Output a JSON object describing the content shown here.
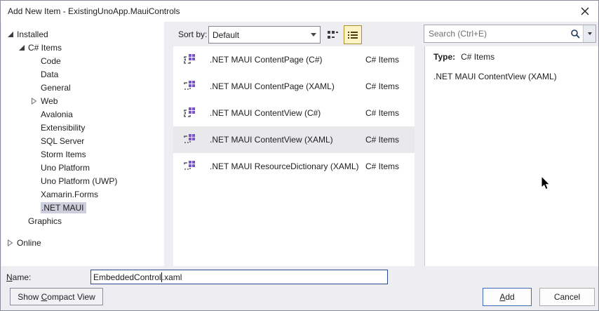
{
  "window": {
    "title": "Add New Item - ExistingUnoApp.MauiControls"
  },
  "toolbar": {
    "sort_by_label": "Sort by:",
    "sort_value": "Default",
    "search_placeholder": "Search (Ctrl+E)"
  },
  "tree": {
    "items": [
      {
        "label": "Installed",
        "state": "expanded",
        "level": 0
      },
      {
        "label": "C# Items",
        "state": "expanded",
        "level": 1
      },
      {
        "label": "Code",
        "level": 2
      },
      {
        "label": "Data",
        "level": 2
      },
      {
        "label": "General",
        "level": 2
      },
      {
        "label": "Web",
        "state": "collapsed",
        "level": 2
      },
      {
        "label": "Avalonia",
        "level": 2
      },
      {
        "label": "Extensibility",
        "level": 2
      },
      {
        "label": "SQL Server",
        "level": 2
      },
      {
        "label": "Storm Items",
        "level": 2
      },
      {
        "label": "Uno Platform",
        "level": 2
      },
      {
        "label": "Uno Platform (UWP)",
        "level": 2
      },
      {
        "label": "Xamarin.Forms",
        "level": 2
      },
      {
        "label": ".NET MAUI",
        "level": 2,
        "selected": true
      },
      {
        "label": "Graphics",
        "level": 1
      },
      {
        "label": "Online",
        "state": "collapsed",
        "level": 0
      }
    ]
  },
  "list": {
    "items": [
      {
        "name": ".NET MAUI ContentPage (C#)",
        "type": "C# Items",
        "icon": "maui-csharp-template-icon"
      },
      {
        "name": ".NET MAUI ContentPage (XAML)",
        "type": "C# Items",
        "icon": "maui-xaml-template-icon"
      },
      {
        "name": ".NET MAUI ContentView (C#)",
        "type": "C# Items",
        "icon": "maui-csharp-template-icon"
      },
      {
        "name": ".NET MAUI ContentView (XAML)",
        "type": "C# Items",
        "icon": "maui-xaml-template-icon",
        "selected": true
      },
      {
        "name": ".NET MAUI ResourceDictionary (XAML)",
        "type": "C# Items",
        "icon": "maui-xaml-template-icon"
      }
    ]
  },
  "details": {
    "type_label": "Type:",
    "type_value": "C# Items",
    "description": ".NET MAUI ContentView (XAML)"
  },
  "footer": {
    "name_label_key": "N",
    "name_label_rest": "ame:",
    "name_value_before_caret": "EmbeddedControl",
    "name_value_after_caret": ".xaml",
    "compact_pre": "Show ",
    "compact_key": "C",
    "compact_post": "ompact View",
    "add_key": "A",
    "add_post": "dd",
    "cancel_label": "Cancel"
  },
  "colors": {
    "dialog_bg": "#eeeef2",
    "panel_bg": "#ffffff",
    "tree_selection": "#cccedb",
    "list_selection": "#e9e9ec",
    "view_toggle_active_bg": "#fdf3c5",
    "view_toggle_active_border": "#a98f2d",
    "name_input_focus_border": "#2c4a8c",
    "default_button_border": "#3c6cb4",
    "template_icon_purple": "#7a55c9"
  }
}
